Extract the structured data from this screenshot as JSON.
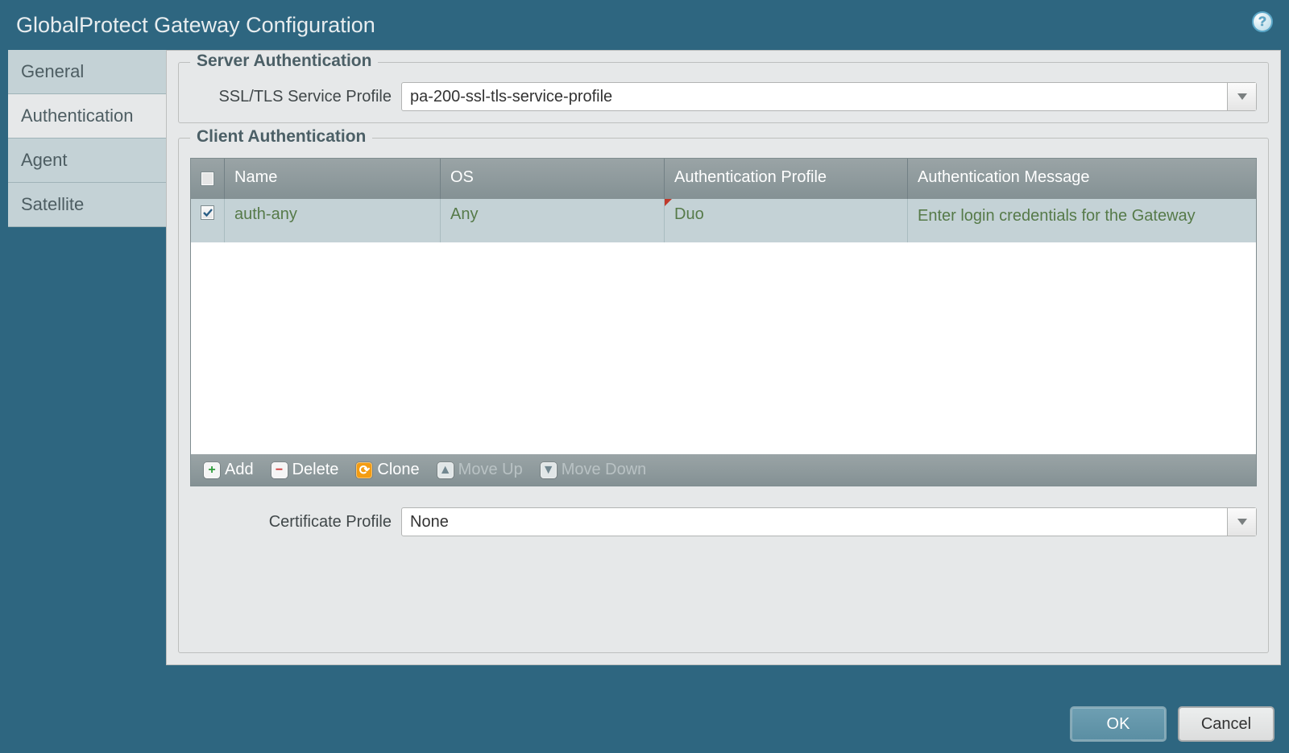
{
  "window": {
    "title": "GlobalProtect Gateway Configuration"
  },
  "tabs": {
    "general": "General",
    "authentication": "Authentication",
    "agent": "Agent",
    "satellite": "Satellite"
  },
  "server_auth": {
    "legend": "Server Authentication",
    "ssl_label": "SSL/TLS Service Profile",
    "ssl_value": "pa-200-ssl-tls-service-profile"
  },
  "client_auth": {
    "legend": "Client Authentication",
    "columns": {
      "name": "Name",
      "os": "OS",
      "profile": "Authentication Profile",
      "message": "Authentication Message"
    },
    "rows": [
      {
        "checked": true,
        "name": "auth-any",
        "os": "Any",
        "profile": "Duo",
        "message": "Enter login credentials for the Gateway"
      }
    ],
    "toolbar": {
      "add": "Add",
      "delete": "Delete",
      "clone": "Clone",
      "move_up": "Move Up",
      "move_down": "Move Down"
    }
  },
  "certificate": {
    "label": "Certificate Profile",
    "value": "None"
  },
  "footer": {
    "ok": "OK",
    "cancel": "Cancel"
  },
  "colors": {
    "accent": "#2e6680",
    "row_teal": "#c4d2d6",
    "green_text": "#567a49"
  }
}
